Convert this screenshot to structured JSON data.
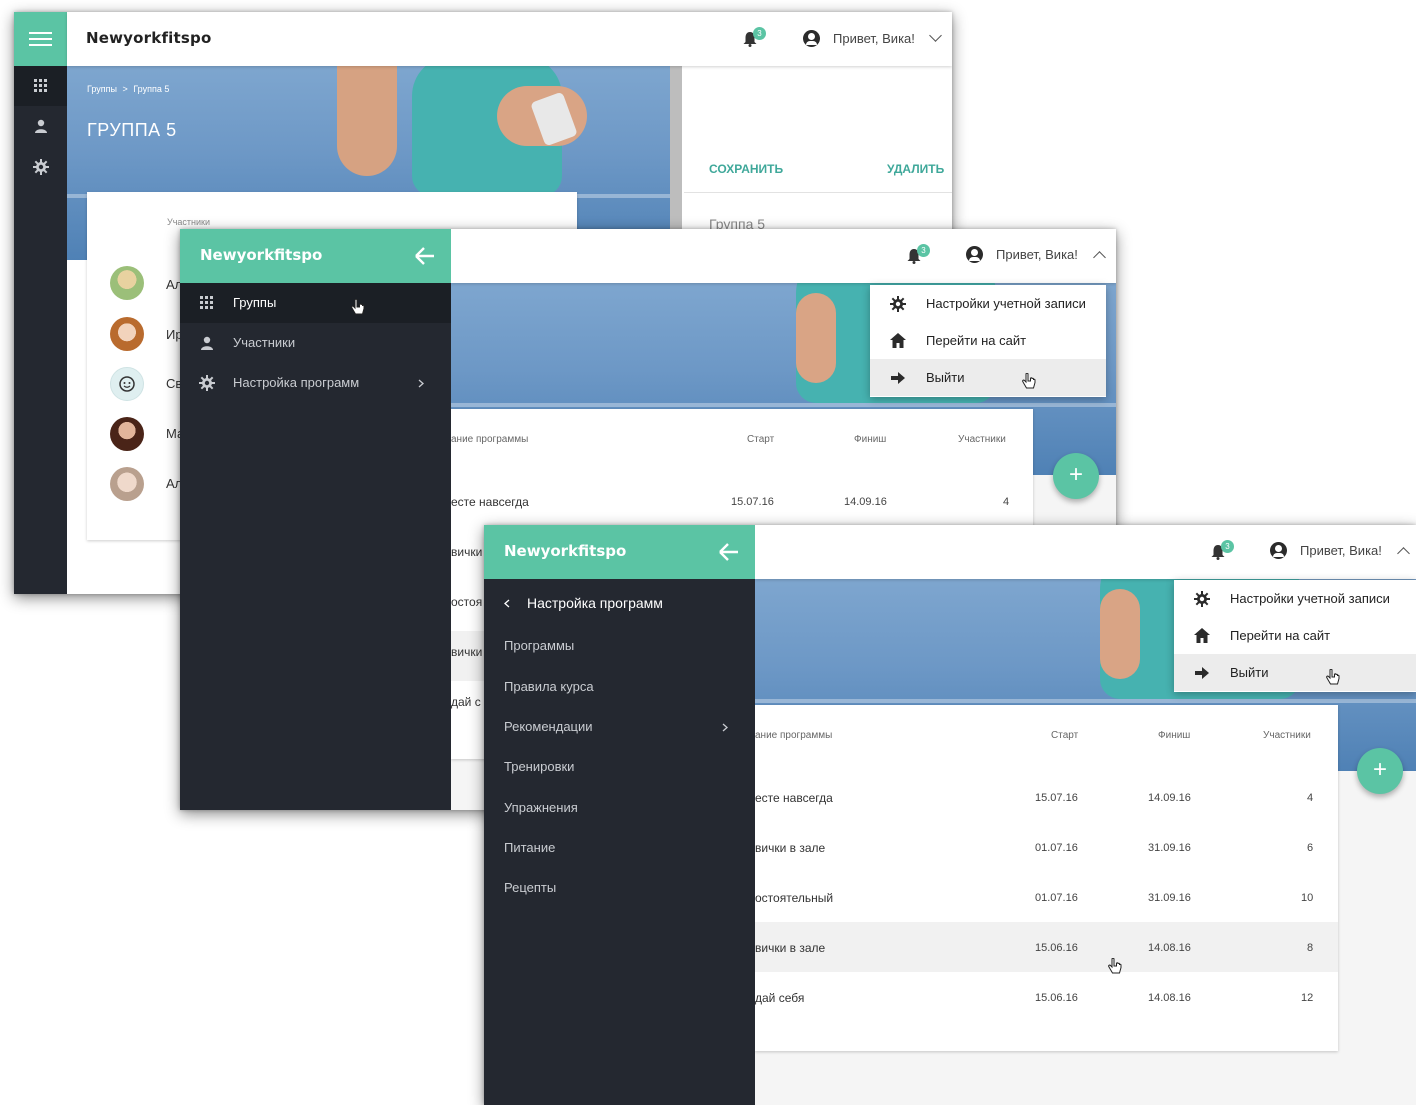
{
  "brand": "Newyorkfitspo",
  "notifications_count": "3",
  "greeting": "Привет, Вика!",
  "accent_color": "#5bc4a4",
  "window1": {
    "breadcrumb": [
      "Группы",
      ">",
      "Группа 5"
    ],
    "page_title": "ГРУППА 5",
    "save_label": "СОХРАНИТЬ",
    "delete_label": "УДАЛИТЬ",
    "group_name_value": "Группа 5",
    "members_label": "Участники",
    "member_name_fragments": [
      "Ал",
      "Ир",
      "Св",
      "Ма",
      "Ал"
    ],
    "rail_icons": [
      "menu-icon",
      "grid-icon",
      "person-icon",
      "gear-icon"
    ]
  },
  "window2": {
    "nav": [
      {
        "icon": "grid-icon",
        "label": "Группы"
      },
      {
        "icon": "person-icon",
        "label": "Участники"
      },
      {
        "icon": "gear-icon",
        "label": "Настройка программ"
      }
    ],
    "dropdown": [
      {
        "icon": "gear-icon",
        "label": "Настройки учетной записи"
      },
      {
        "icon": "home-icon",
        "label": "Перейти на сайт"
      },
      {
        "icon": "logout-icon",
        "label": "Выйти"
      }
    ],
    "table_headers": [
      "ание программы",
      "Старт",
      "Финиш",
      "Участники"
    ],
    "visible_row": {
      "name": "есте навсегда",
      "start": "15.07.16",
      "finish": "14.09.16",
      "members": "4"
    },
    "peek_names": [
      "вички",
      "остоя",
      "вички",
      "дай с"
    ]
  },
  "window3": {
    "sub_header": "Настройка программ",
    "sub_items": [
      "Программы",
      "Правила курса",
      "Рекомендации",
      "Тренировки",
      "Упражнения",
      "Питание",
      "Рецепты"
    ],
    "dropdown": [
      {
        "icon": "gear-icon",
        "label": "Настройки учетной записи"
      },
      {
        "icon": "home-icon",
        "label": "Перейти на сайт"
      },
      {
        "icon": "logout-icon",
        "label": "Выйти"
      }
    ],
    "table_headers": [
      "ание программы",
      "Старт",
      "Финиш",
      "Участники"
    ],
    "rows": [
      {
        "name": "есте навсегда",
        "start": "15.07.16",
        "finish": "14.09.16",
        "members": "4"
      },
      {
        "name": "вички в зале",
        "start": "01.07.16",
        "finish": "31.09.16",
        "members": "6"
      },
      {
        "name": "остоятельный",
        "start": "01.07.16",
        "finish": "31.09.16",
        "members": "10"
      },
      {
        "name": "вички в зале",
        "start": "15.06.16",
        "finish": "14.08.16",
        "members": "8"
      },
      {
        "name": "дай себя",
        "start": "15.06.16",
        "finish": "14.08.16",
        "members": "12"
      }
    ],
    "hovered_row": 3
  }
}
